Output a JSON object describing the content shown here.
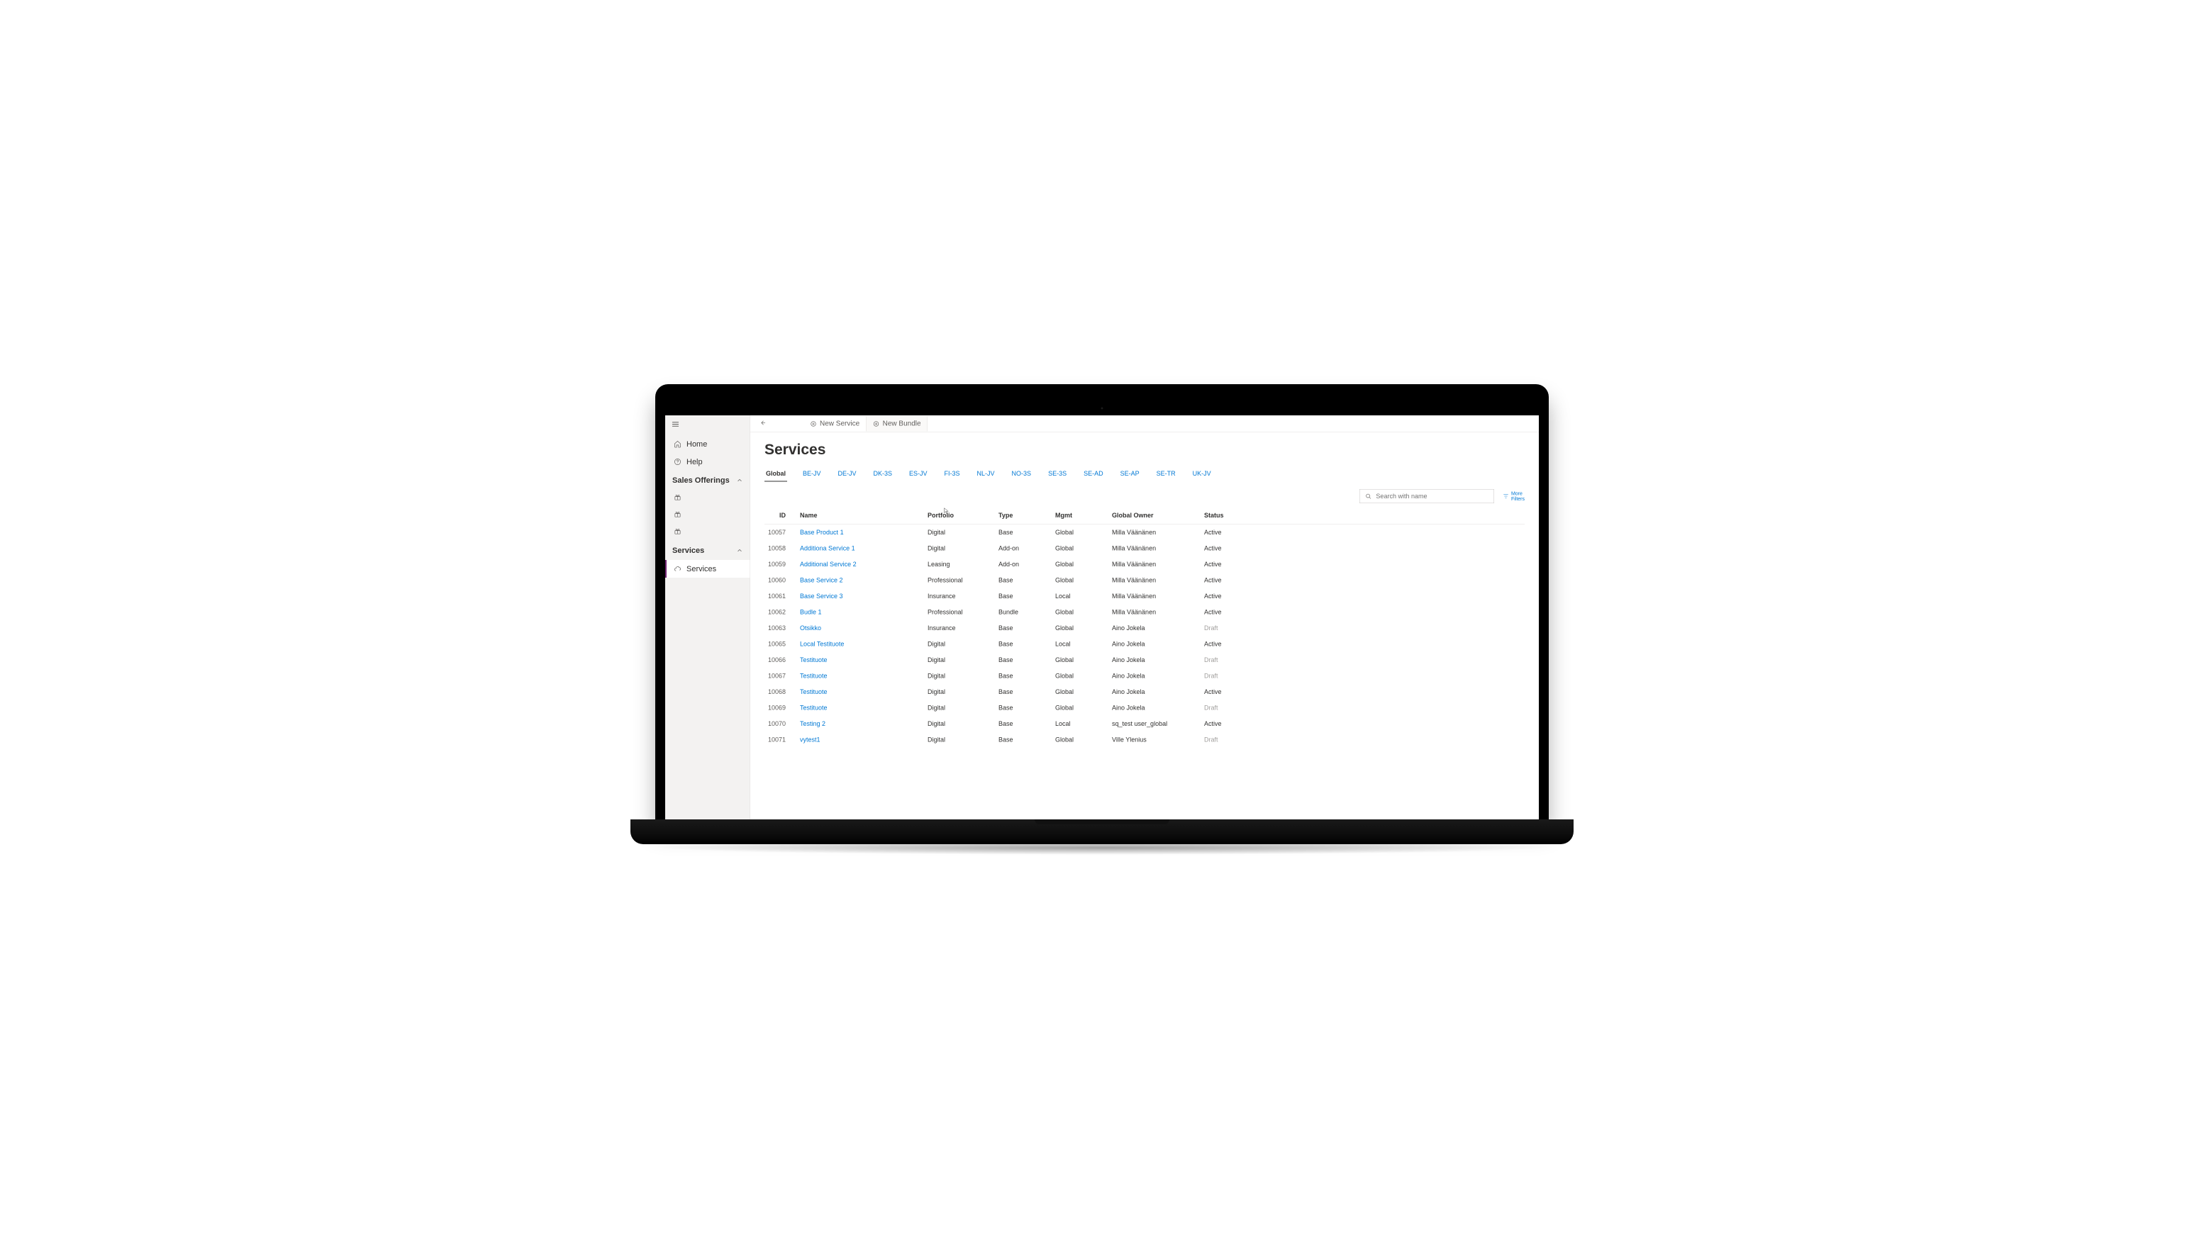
{
  "sidebar": {
    "home": "Home",
    "help": "Help",
    "section_offerings": "Sales Offerings",
    "section_services": "Services",
    "services_item": "Services"
  },
  "toolbar": {
    "new_service": "New Service",
    "new_bundle": "New Bundle"
  },
  "page": {
    "title": "Services"
  },
  "tabs": [
    "Global",
    "BE-JV",
    "DE-JV",
    "DK-3S",
    "ES-JV",
    "FI-3S",
    "NL-JV",
    "NO-3S",
    "SE-3S",
    "SE-AD",
    "SE-AP",
    "SE-TR",
    "UK-JV"
  ],
  "active_tab": "Global",
  "search": {
    "placeholder": "Search with name"
  },
  "more_filters": {
    "line1": "More",
    "line2": "Filters"
  },
  "columns": [
    "ID",
    "Name",
    "Portfolio",
    "Type",
    "Mgmt",
    "Global Owner",
    "Status"
  ],
  "rows": [
    {
      "id": "10057",
      "name": "Base Product 1",
      "portfolio": "Digital",
      "type": "Base",
      "mgmt": "Global",
      "owner": "Milla Väänänen",
      "status": "Active"
    },
    {
      "id": "10058",
      "name": "Additiona Service 1",
      "portfolio": "Digital",
      "type": "Add-on",
      "mgmt": "Global",
      "owner": "Milla Väänänen",
      "status": "Active"
    },
    {
      "id": "10059",
      "name": "Additional Service 2",
      "portfolio": "Leasing",
      "type": "Add-on",
      "mgmt": "Global",
      "owner": "Milla Väänänen",
      "status": "Active"
    },
    {
      "id": "10060",
      "name": "Base Service 2",
      "portfolio": "Professional",
      "type": "Base",
      "mgmt": "Global",
      "owner": "Milla Väänänen",
      "status": "Active"
    },
    {
      "id": "10061",
      "name": "Base Service 3",
      "portfolio": "Insurance",
      "type": "Base",
      "mgmt": "Local",
      "owner": "Milla Väänänen",
      "status": "Active"
    },
    {
      "id": "10062",
      "name": "Budle 1",
      "portfolio": "Professional",
      "type": "Bundle",
      "mgmt": "Global",
      "owner": "Milla Väänänen",
      "status": "Active"
    },
    {
      "id": "10063",
      "name": "Otsikko",
      "portfolio": "Insurance",
      "type": "Base",
      "mgmt": "Global",
      "owner": "Aino Jokela",
      "status": "Draft"
    },
    {
      "id": "10065",
      "name": "Local Testituote",
      "portfolio": "Digital",
      "type": "Base",
      "mgmt": "Local",
      "owner": "Aino Jokela",
      "status": "Active"
    },
    {
      "id": "10066",
      "name": "Testituote",
      "portfolio": "Digital",
      "type": "Base",
      "mgmt": "Global",
      "owner": "Aino Jokela",
      "status": "Draft"
    },
    {
      "id": "10067",
      "name": "Testituote",
      "portfolio": "Digital",
      "type": "Base",
      "mgmt": "Global",
      "owner": "Aino Jokela",
      "status": "Draft"
    },
    {
      "id": "10068",
      "name": "Testituote",
      "portfolio": "Digital",
      "type": "Base",
      "mgmt": "Global",
      "owner": "Aino Jokela",
      "status": "Active"
    },
    {
      "id": "10069",
      "name": "Testituote",
      "portfolio": "Digital",
      "type": "Base",
      "mgmt": "Global",
      "owner": "Aino Jokela",
      "status": "Draft"
    },
    {
      "id": "10070",
      "name": "Testing 2",
      "portfolio": "Digital",
      "type": "Base",
      "mgmt": "Local",
      "owner": "sq_test user_global",
      "status": "Active"
    },
    {
      "id": "10071",
      "name": "vytest1",
      "portfolio": "Digital",
      "type": "Base",
      "mgmt": "Global",
      "owner": "Ville Ylenius",
      "status": "Draft"
    }
  ]
}
